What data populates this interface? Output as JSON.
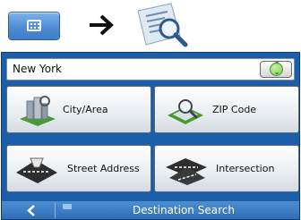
{
  "location_selector": {
    "value": "New York",
    "spin_icon": "up-down-arrows-icon"
  },
  "tiles": [
    {
      "label": "City/Area",
      "icon": "city-area-icon"
    },
    {
      "label": "ZIP Code",
      "icon": "zip-code-icon"
    },
    {
      "label": "Street Address",
      "icon": "street-address-icon"
    },
    {
      "label": "Intersection",
      "icon": "intersection-icon"
    }
  ],
  "bottom_bar": {
    "title": "Destination Search",
    "back_icon": "back-arrow-icon"
  },
  "instruction": {
    "step1_icon": "keypad-icon",
    "arrow_icon": "right-arrow-icon",
    "step2_icon": "destination-search-icon"
  },
  "colors": {
    "screen_blue": "#1d5ea8",
    "bar_blue": "#3f7fc7"
  }
}
